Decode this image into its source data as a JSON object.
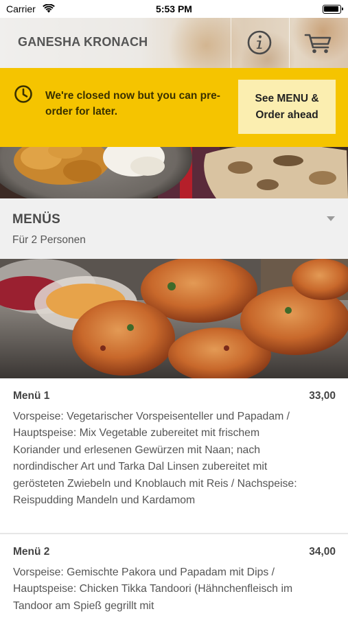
{
  "status_bar": {
    "carrier": "Carrier",
    "time": "5:53 PM"
  },
  "header": {
    "restaurant_name": "GANESHA KRONACH",
    "info_icon": "info-circle-icon",
    "cart_icon": "shopping-cart-icon"
  },
  "closed_banner": {
    "message": "We're closed now but you can pre-order for later.",
    "button_label": "See MENU &\nOrder ahead",
    "icon": "clock-icon",
    "background_color": "#f5c400"
  },
  "category": {
    "title": "MENÜS",
    "subtitle": "Für 2 Personen",
    "chevron_icon": "chevron-down-icon"
  },
  "menu_items": [
    {
      "name": "Menü 1",
      "price": "33,00",
      "description": "Vorspeise: Vegetarischer Vorspeisenteller und Papadam / Hauptspeise: Mix Vegetable zubereitet mit frischem Koriander und erlesenen Gewürzen mit Naan; nach nordindischer Art und Tarka Dal Linsen zubereitet mit gerösteten Zwiebeln und Knoblauch mit Reis / Nachspeise: Reispudding Mandeln und Kardamom"
    },
    {
      "name": "Menü 2",
      "price": "34,00",
      "description": "Vorspeise: Gemischte Pakora und Papadam mit Dips / Hauptspeise: Chicken Tikka Tandoori (Hähnchenfleisch im Tandoor am Spieß gegrillt mit"
    }
  ]
}
